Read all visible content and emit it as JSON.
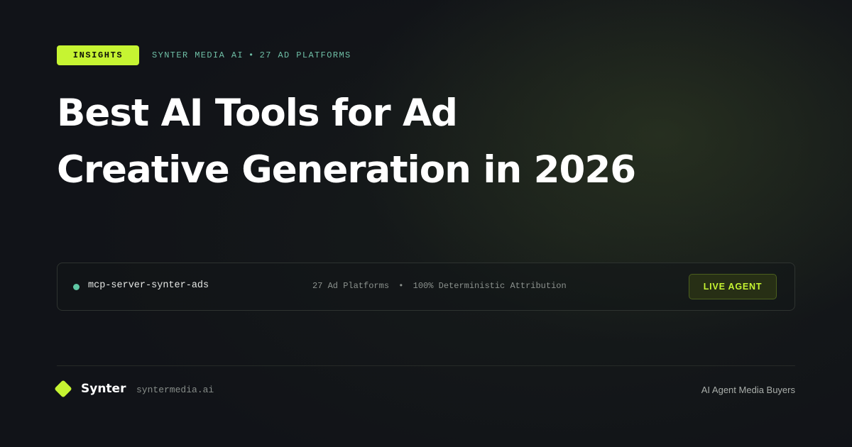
{
  "header": {
    "badge": "INSIGHTS",
    "kicker": {
      "brand": "SYNTER MEDIA AI",
      "separator": "•",
      "platforms": "27 AD PLATFORMS"
    }
  },
  "title": {
    "line1": "Best AI Tools for Ad",
    "line2": "Creative Generation in 2026"
  },
  "agent_bar": {
    "status_color": "#5fc7a4",
    "server_name": "mcp-server-synter-ads",
    "note": {
      "platforms": "27 Ad Platforms",
      "separator": "•",
      "attribution": "100% Deterministic Attribution"
    },
    "button_label": "LIVE AGENT"
  },
  "footer": {
    "logo_icon": "diamond-logo-icon",
    "brand": "Synter",
    "domain": "syntermedia.ai",
    "tagline": "AI Agent Media Buyers"
  },
  "colors": {
    "accent": "#c6f432",
    "background": "#111318",
    "teal": "#6fbfa6"
  }
}
